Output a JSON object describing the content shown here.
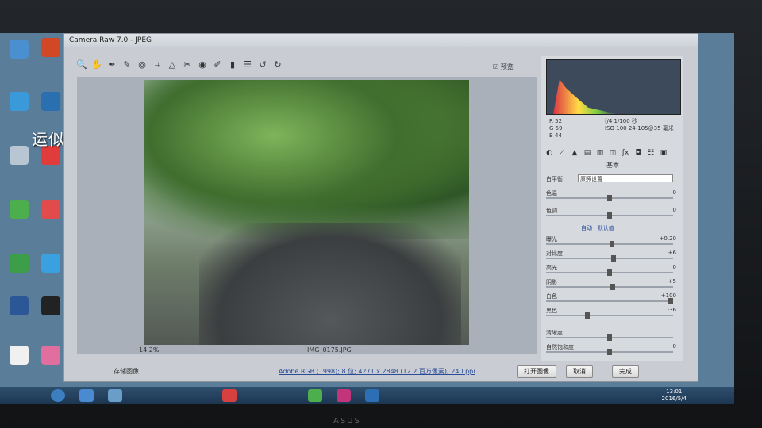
{
  "window": {
    "title": "Camera Raw 7.0 - JPEG"
  },
  "overlay_caption": "运似轻舟 世间沧海",
  "toolbar": {
    "tools": [
      "zoom-icon",
      "hand-icon",
      "eyedropper-icon",
      "color-sampler-icon",
      "target-icon",
      "crop-icon",
      "straighten-icon",
      "spot-removal-icon",
      "red-eye-icon",
      "adjustment-brush-icon",
      "graduated-filter-icon",
      "preferences-icon",
      "rotate-left-icon",
      "rotate-right-icon"
    ],
    "preview_label": "预览"
  },
  "canvas": {
    "zoom": "14.2%",
    "file_name": "IMG_0175.JPG"
  },
  "histogram": {
    "readout": {
      "r_label": "R",
      "r": "52",
      "g_label": "G",
      "g": "59",
      "b_label": "B",
      "b": "44"
    },
    "exif": {
      "aperture": "f/4",
      "shutter": "1/100 秒",
      "iso": "ISO 100",
      "lens": "24-105@35 毫米"
    }
  },
  "panel": {
    "section": "基本",
    "white_balance_label": "白平衡",
    "white_balance_value": "原照设置",
    "auto_label": "自动",
    "default_label": "默认值",
    "rows": [
      {
        "label": "色温",
        "value": "0"
      },
      {
        "label": "色调",
        "value": "0"
      },
      {
        "label": "曝光",
        "value": "+0.20"
      },
      {
        "label": "对比度",
        "value": "+6"
      },
      {
        "label": "高光",
        "value": "0"
      },
      {
        "label": "阴影",
        "value": "+5"
      },
      {
        "label": "白色",
        "value": "+100"
      },
      {
        "label": "黑色",
        "value": "-36"
      },
      {
        "label": "清晰度",
        "value": ""
      },
      {
        "label": "自然饱和度",
        "value": "0"
      }
    ]
  },
  "footer": {
    "save_button": "存储图像...",
    "workflow_link": "Adobe RGB (1998); 8 位; 4271 x 2848 (12.2 百万像素); 240 ppi",
    "open_button": "打开图像",
    "cancel_button": "取消",
    "done_button": "完成"
  },
  "taskbar": {
    "time": "13:01",
    "date": "2016/5/4"
  },
  "laptop_brand": "ASUS"
}
